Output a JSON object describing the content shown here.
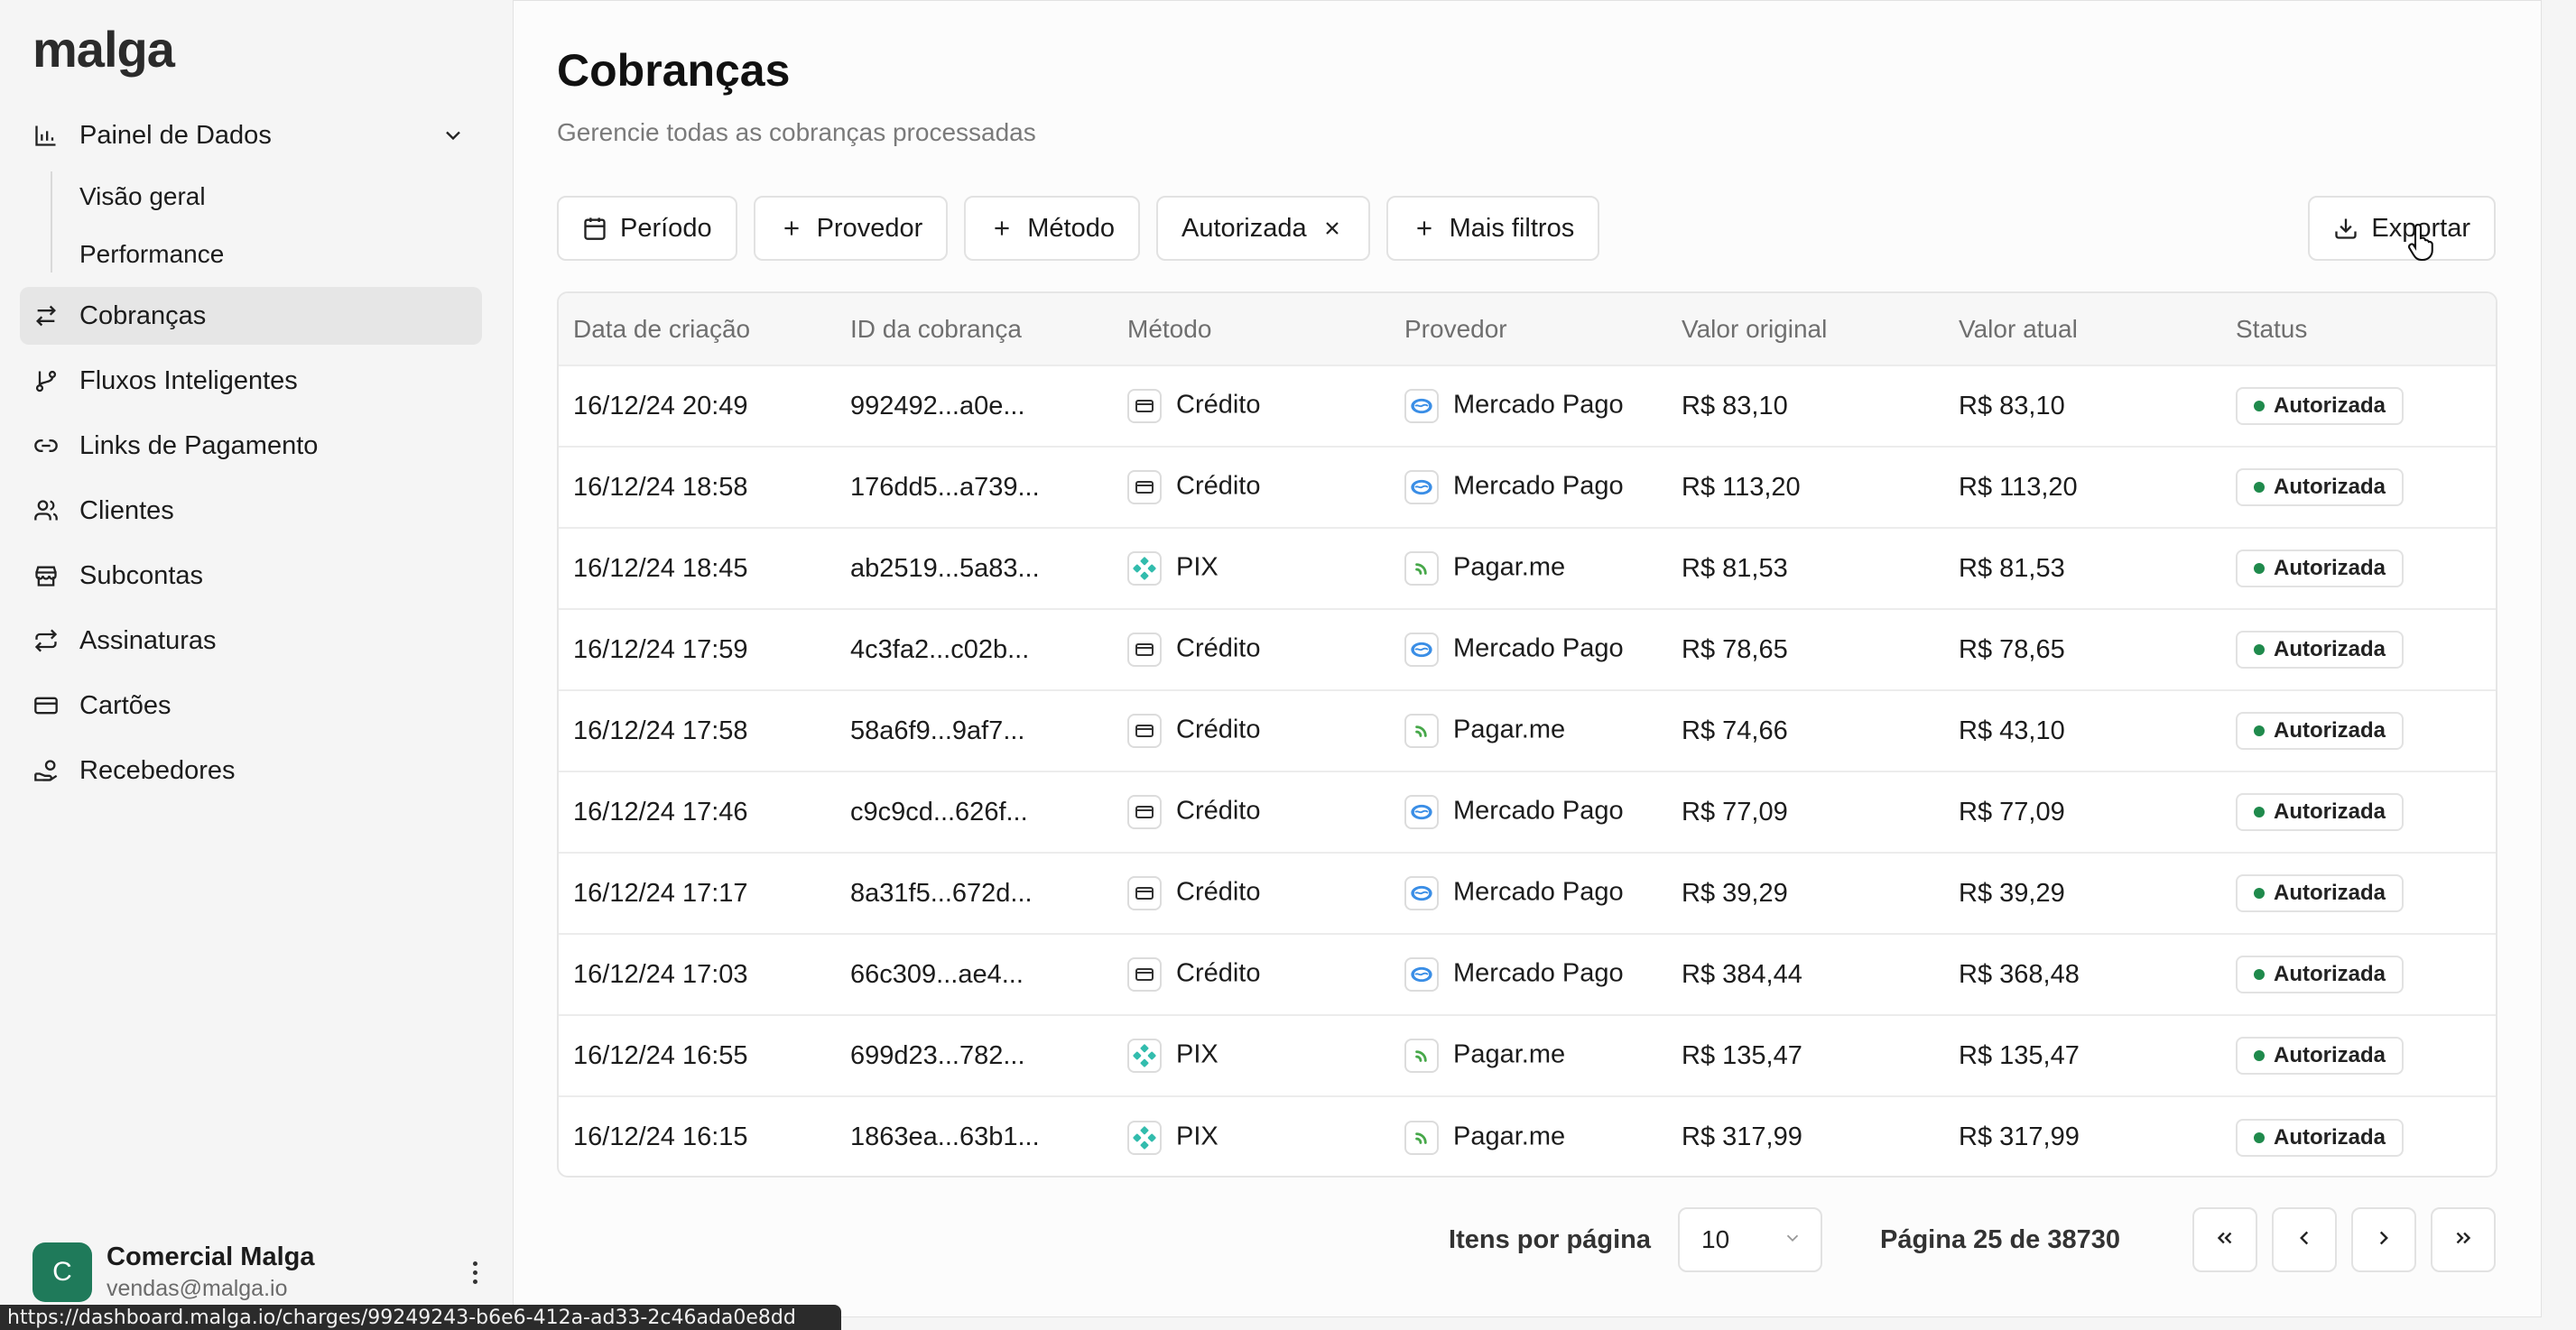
{
  "app": {
    "logo": "malga"
  },
  "sidebar": {
    "items": [
      {
        "label": "Painel de Dados",
        "icon": "bar-chart-icon",
        "expanded": true,
        "children": [
          {
            "label": "Visão geral"
          },
          {
            "label": "Performance"
          }
        ]
      },
      {
        "label": "Cobranças",
        "icon": "arrows-swap-icon",
        "active": true
      },
      {
        "label": "Fluxos Inteligentes",
        "icon": "git-branch-icon"
      },
      {
        "label": "Links de Pagamento",
        "icon": "link-icon"
      },
      {
        "label": "Clientes",
        "icon": "users-icon"
      },
      {
        "label": "Subcontas",
        "icon": "store-icon"
      },
      {
        "label": "Assinaturas",
        "icon": "repeat-icon"
      },
      {
        "label": "Cartões",
        "icon": "credit-card-icon"
      },
      {
        "label": "Recebedores",
        "icon": "hand-coins-icon"
      }
    ],
    "user": {
      "initial": "C",
      "name": "Comercial Malga",
      "email": "vendas@malga.io"
    }
  },
  "page": {
    "title": "Cobranças",
    "subtitle": "Gerencie todas as cobranças processadas"
  },
  "filters": {
    "period": "Período",
    "provider": "Provedor",
    "method": "Método",
    "status_chip": "Autorizada",
    "more": "Mais filtros",
    "export": "Exportar"
  },
  "table": {
    "columns": [
      "Data de criação",
      "ID da cobrança",
      "Método",
      "Provedor",
      "Valor original",
      "Valor atual",
      "Status"
    ],
    "rows": [
      {
        "date": "16/12/24 20:49",
        "id": "992492...a0e...",
        "method": "Crédito",
        "provider": "Mercado Pago",
        "original": "R$ 83,10",
        "current": "R$ 83,10",
        "status": "Autorizada"
      },
      {
        "date": "16/12/24 18:58",
        "id": "176dd5...a739...",
        "method": "Crédito",
        "provider": "Mercado Pago",
        "original": "R$ 113,20",
        "current": "R$ 113,20",
        "status": "Autorizada"
      },
      {
        "date": "16/12/24 18:45",
        "id": "ab2519...5a83...",
        "method": "PIX",
        "provider": "Pagar.me",
        "original": "R$ 81,53",
        "current": "R$ 81,53",
        "status": "Autorizada"
      },
      {
        "date": "16/12/24 17:59",
        "id": "4c3fa2...c02b...",
        "method": "Crédito",
        "provider": "Mercado Pago",
        "original": "R$ 78,65",
        "current": "R$ 78,65",
        "status": "Autorizada"
      },
      {
        "date": "16/12/24 17:58",
        "id": "58a6f9...9af7...",
        "method": "Crédito",
        "provider": "Pagar.me",
        "original": "R$ 74,66",
        "current": "R$ 43,10",
        "status": "Autorizada"
      },
      {
        "date": "16/12/24 17:46",
        "id": "c9c9cd...626f...",
        "method": "Crédito",
        "provider": "Mercado Pago",
        "original": "R$ 77,09",
        "current": "R$ 77,09",
        "status": "Autorizada"
      },
      {
        "date": "16/12/24 17:17",
        "id": "8a31f5...672d...",
        "method": "Crédito",
        "provider": "Mercado Pago",
        "original": "R$ 39,29",
        "current": "R$ 39,29",
        "status": "Autorizada"
      },
      {
        "date": "16/12/24 17:03",
        "id": "66c309...ae4...",
        "method": "Crédito",
        "provider": "Mercado Pago",
        "original": "R$ 384,44",
        "current": "R$ 368,48",
        "status": "Autorizada"
      },
      {
        "date": "16/12/24 16:55",
        "id": "699d23...782...",
        "method": "PIX",
        "provider": "Pagar.me",
        "original": "R$ 135,47",
        "current": "R$ 135,47",
        "status": "Autorizada"
      },
      {
        "date": "16/12/24 16:15",
        "id": "1863ea...63b1...",
        "method": "PIX",
        "provider": "Pagar.me",
        "original": "R$ 317,99",
        "current": "R$ 317,99",
        "status": "Autorizada"
      }
    ]
  },
  "pagination": {
    "items_label": "Itens por página",
    "page_size": "10",
    "page_info": "Página 25 de 38730"
  },
  "statusbar": {
    "url": "https://dashboard.malga.io/charges/99249243-b6e6-412a-ad33-2c46ada0e8dd"
  },
  "colors": {
    "accent": "#1f7a5a",
    "status_ok": "#1f8a4c"
  }
}
